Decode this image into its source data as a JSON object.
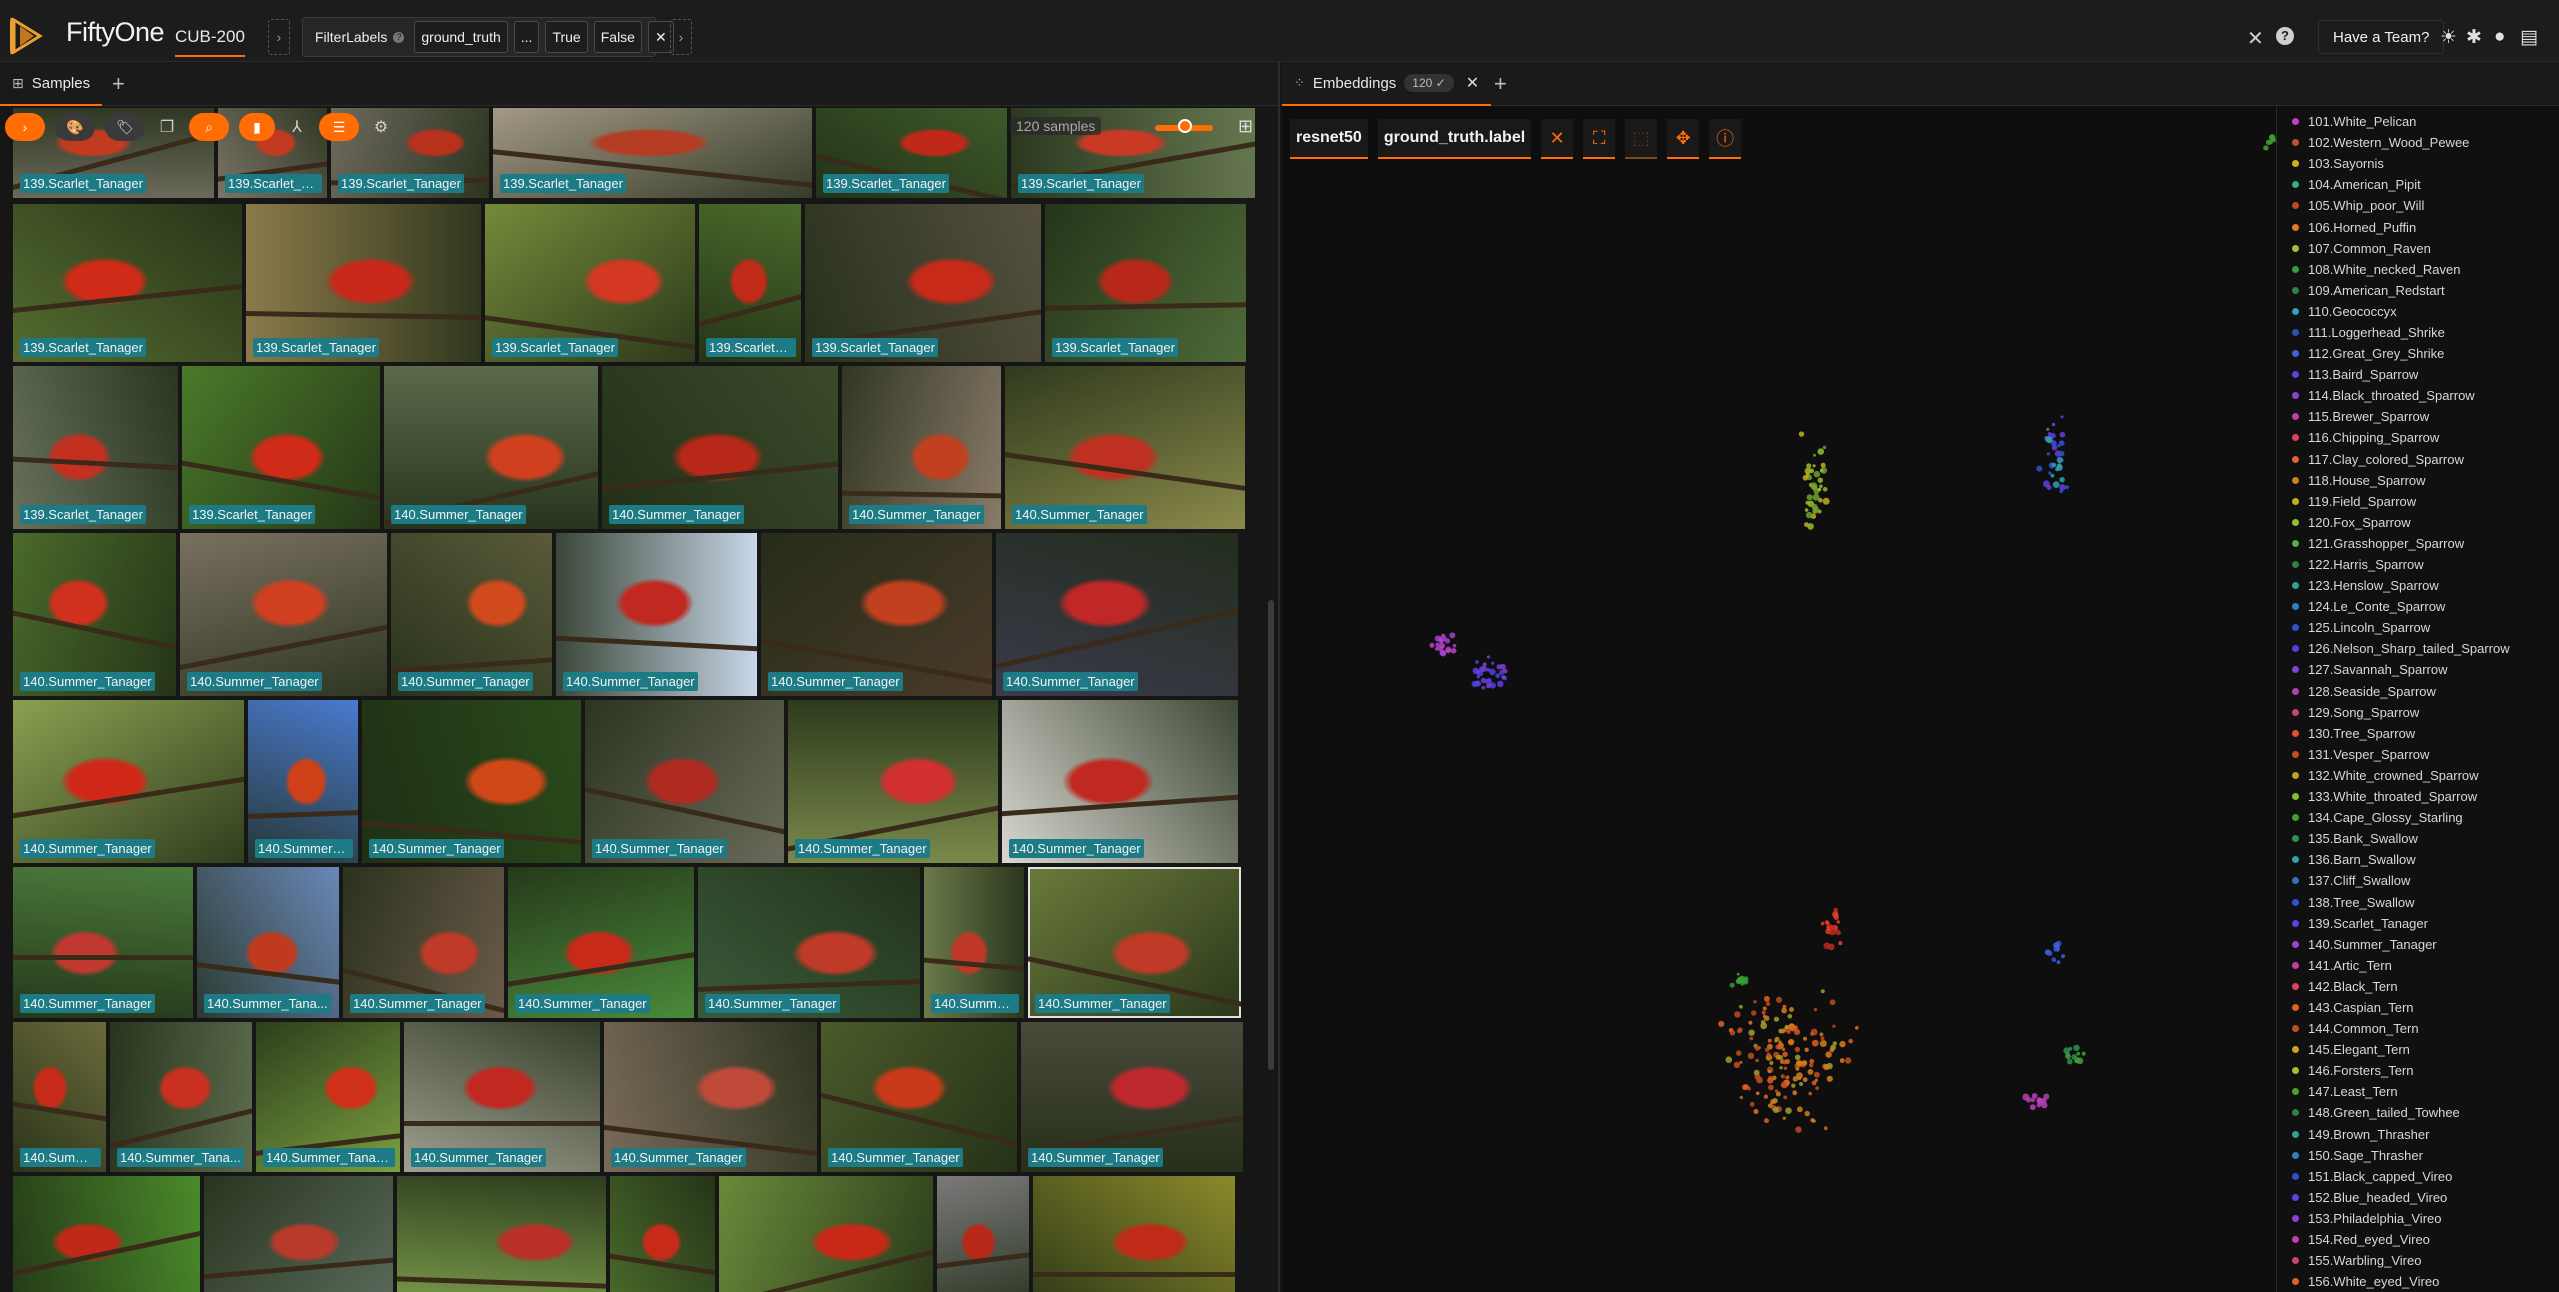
{
  "app": {
    "title": "FiftyOne",
    "dataset": "CUB-200",
    "team_button": "Have a Team?"
  },
  "filter": {
    "operator": "FilterLabels",
    "field": "ground_truth",
    "ellipsis": "...",
    "true_label": "True",
    "false_label": "False"
  },
  "samples_panel": {
    "tab_label": "Samples",
    "count_text": "120 samples"
  },
  "embeddings_panel": {
    "tab_label": "Embeddings",
    "badge": "120 ✓",
    "brain_key": "resnet50",
    "color_by": "ground_truth.label"
  },
  "colors": {
    "accent": "#ff6d04",
    "label_bg": "#1d7b86",
    "background": "#161616"
  },
  "grid": {
    "rows": [
      [
        {
          "label": "139.Scarlet_Tanager",
          "c1": "#6b6a5a",
          "c2": "#c23a20"
        },
        {
          "label": "139.Scarlet_Ta...",
          "c1": "#7a7466",
          "c2": "#c23a20"
        },
        {
          "label": "139.Scarlet_Tanager",
          "c1": "#6e6a5e",
          "c2": "#b8311c"
        },
        {
          "label": "139.Scarlet_Tanager",
          "c1": "#a59a88",
          "c2": "#b43c22"
        },
        {
          "label": "139.Scarlet_Tanager",
          "c1": "#3e5a2a",
          "c2": "#c0281a"
        },
        {
          "label": "139.Scarlet_Tanager",
          "c1": "#667850",
          "c2": "#c83a24"
        }
      ],
      [
        {
          "label": "139.Scarlet_Tanager",
          "c1": "#556b2f",
          "c2": "#d02a18"
        },
        {
          "label": "139.Scarlet_Tanager",
          "c1": "#8a7a4a",
          "c2": "#c8281a"
        },
        {
          "label": "139.Scarlet_Tanager",
          "c1": "#748a3a",
          "c2": "#d43822"
        },
        {
          "label": "139.Scarlet_T...",
          "c1": "#4a6a2a",
          "c2": "#c02a18"
        },
        {
          "label": "139.Scarlet_Tanager",
          "c1": "#55503e",
          "c2": "#c82a1a"
        },
        {
          "label": "139.Scarlet_Tanager",
          "c1": "#4e6a38",
          "c2": "#b82818"
        }
      ],
      [
        {
          "label": "139.Scarlet_Tanager",
          "c1": "#66705a",
          "c2": "#c43020"
        },
        {
          "label": "139.Scarlet_Tanager",
          "c1": "#4a7a2a",
          "c2": "#d02a18"
        },
        {
          "label": "140.Summer_Tanager",
          "c1": "#5a6a4a",
          "c2": "#d0401e"
        },
        {
          "label": "140.Summer_Tanager",
          "c1": "#3a4a2a",
          "c2": "#b82818"
        },
        {
          "label": "140.Summer_Tanager",
          "c1": "#8a7a6a",
          "c2": "#c04020"
        },
        {
          "label": "140.Summer_Tanager",
          "c1": "#8a8a4a",
          "c2": "#c03020"
        }
      ],
      [
        {
          "label": "140.Summer_Tanager",
          "c1": "#4a6a2a",
          "c2": "#d0301e"
        },
        {
          "label": "140.Summer_Tanager",
          "c1": "#7a7060",
          "c2": "#d04020"
        },
        {
          "label": "140.Summer_Tanager",
          "c1": "#5a5a3a",
          "c2": "#d04a1e"
        },
        {
          "label": "140.Summer_Tanager",
          "c1": "#c8d6e8",
          "c2": "#c02820"
        },
        {
          "label": "140.Summer_Tanager",
          "c1": "#4a3a2a",
          "c2": "#c04020"
        },
        {
          "label": "140.Summer_Tanager",
          "c1": "#3a3a4a",
          "c2": "#c02828"
        }
      ],
      [
        {
          "label": "140.Summer_Tanager",
          "c1": "#8aa050",
          "c2": "#d02818"
        },
        {
          "label": "140.Summer_...",
          "c1": "#4a7ad0",
          "c2": "#d04018"
        },
        {
          "label": "140.Summer_Tanager",
          "c1": "#2a4a1a",
          "c2": "#d04818"
        },
        {
          "label": "140.Summer_Tanager",
          "c1": "#6a6a5a",
          "c2": "#b02a20"
        },
        {
          "label": "140.Summer_Tanager",
          "c1": "#7a8a4a",
          "c2": "#d03030"
        },
        {
          "label": "140.Summer_Tanager",
          "c1": "#d8d8d0",
          "c2": "#c02820"
        }
      ],
      [
        {
          "label": "140.Summer_Tanager",
          "c1": "#4a7a3a",
          "c2": "#c03830"
        },
        {
          "label": "140.Summer_Tana...",
          "c1": "#6a88b8",
          "c2": "#c03a20"
        },
        {
          "label": "140.Summer_Tanager",
          "c1": "#6a5a4a",
          "c2": "#c03a28"
        },
        {
          "label": "140.Summer_Tanager",
          "c1": "#4a8a3a",
          "c2": "#c82a1a"
        },
        {
          "label": "140.Summer_Tanager",
          "c1": "#3a5a3a",
          "c2": "#c03a28"
        },
        {
          "label": "140.Summer_...",
          "c1": "#6a7a4a",
          "c2": "#c03828"
        },
        {
          "label": "140.Summer_Tanager",
          "c1": "#6a7a3a",
          "c2": "#c03a28"
        }
      ],
      [
        {
          "label": "140.Summe...",
          "c1": "#6a6a3a",
          "c2": "#c82a1a"
        },
        {
          "label": "140.Summer_Tana...",
          "c1": "#5a6a4a",
          "c2": "#c83020"
        },
        {
          "label": "140.Summer_Tanag...",
          "c1": "#7aa040",
          "c2": "#d03018"
        },
        {
          "label": "140.Summer_Tanager",
          "c1": "#a0a090",
          "c2": "#c02820"
        },
        {
          "label": "140.Summer_Tanager",
          "c1": "#7a6a5a",
          "c2": "#c04a3a"
        },
        {
          "label": "140.Summer_Tanager",
          "c1": "#4a5a2a",
          "c2": "#c83a1a"
        },
        {
          "label": "140.Summer_Tanager",
          "c1": "#4a4a3a",
          "c2": "#c02830"
        }
      ],
      [
        {
          "label": "",
          "c1": "#4a8a2a",
          "c2": "#c02818"
        },
        {
          "label": "",
          "c1": "#5a6a5a",
          "c2": "#b83a2a"
        },
        {
          "label": "",
          "c1": "#7a9a4a",
          "c2": "#b83028"
        },
        {
          "label": "",
          "c1": "#4a6a2a",
          "c2": "#c82a18"
        },
        {
          "label": "",
          "c1": "#6a8a3a",
          "c2": "#c82818"
        },
        {
          "label": "",
          "c1": "#7a7a7a",
          "c2": "#b82818"
        },
        {
          "label": "",
          "c1": "#8a8a2a",
          "c2": "#c02a18"
        }
      ]
    ]
  },
  "legend": [
    {
      "label": "101.White_Pelican",
      "color": "#c040c0"
    },
    {
      "label": "102.Western_Wood_Pewee",
      "color": "#c05030"
    },
    {
      "label": "103.Sayornis",
      "color": "#d0b020"
    },
    {
      "label": "104.American_Pipit",
      "color": "#30b080"
    },
    {
      "label": "105.Whip_poor_Will",
      "color": "#c04a20"
    },
    {
      "label": "106.Horned_Puffin",
      "color": "#e07a20"
    },
    {
      "label": "107.Common_Raven",
      "color": "#a0c030"
    },
    {
      "label": "108.White_necked_Raven",
      "color": "#30a040"
    },
    {
      "label": "109.American_Redstart",
      "color": "#308050"
    },
    {
      "label": "110.Geococcyx",
      "color": "#30a0c0"
    },
    {
      "label": "111.Loggerhead_Shrike",
      "color": "#3050b0"
    },
    {
      "label": "112.Great_Grey_Shrike",
      "color": "#4060e0"
    },
    {
      "label": "113.Baird_Sparrow",
      "color": "#6040e0"
    },
    {
      "label": "114.Black_throated_Sparrow",
      "color": "#9040d0"
    },
    {
      "label": "115.Brewer_Sparrow",
      "color": "#c040a0"
    },
    {
      "label": "116.Chipping_Sparrow",
      "color": "#e04060"
    },
    {
      "label": "117.Clay_colored_Sparrow",
      "color": "#e06030"
    },
    {
      "label": "118.House_Sparrow",
      "color": "#d08020"
    },
    {
      "label": "119.Field_Sparrow",
      "color": "#c0b020"
    },
    {
      "label": "120.Fox_Sparrow",
      "color": "#90c030"
    },
    {
      "label": "121.Grasshopper_Sparrow",
      "color": "#50b040"
    },
    {
      "label": "122.Harris_Sparrow",
      "color": "#308040"
    },
    {
      "label": "123.Henslow_Sparrow",
      "color": "#30a090"
    },
    {
      "label": "124.Le_Conte_Sparrow",
      "color": "#3080c0"
    },
    {
      "label": "125.Lincoln_Sparrow",
      "color": "#3050d0"
    },
    {
      "label": "126.Nelson_Sharp_tailed_Sparrow",
      "color": "#5040e0"
    },
    {
      "label": "127.Savannah_Sparrow",
      "color": "#8040d0"
    },
    {
      "label": "128.Seaside_Sparrow",
      "color": "#b040b0"
    },
    {
      "label": "129.Song_Sparrow",
      "color": "#d04070"
    },
    {
      "label": "130.Tree_Sparrow",
      "color": "#e05030"
    },
    {
      "label": "131.Vesper_Sparrow",
      "color": "#c05020"
    },
    {
      "label": "132.White_crowned_Sparrow",
      "color": "#c0a020"
    },
    {
      "label": "133.White_throated_Sparrow",
      "color": "#80c030"
    },
    {
      "label": "134.Cape_Glossy_Starling",
      "color": "#40a030"
    },
    {
      "label": "135.Bank_Swallow",
      "color": "#309050"
    },
    {
      "label": "136.Barn_Swallow",
      "color": "#30a0b0"
    },
    {
      "label": "137.Cliff_Swallow",
      "color": "#3070c0"
    },
    {
      "label": "138.Tree_Swallow",
      "color": "#3050e0"
    },
    {
      "label": "139.Scarlet_Tanager",
      "color": "#6040e0"
    },
    {
      "label": "140.Summer_Tanager",
      "color": "#a040d0"
    },
    {
      "label": "141.Artic_Tern",
      "color": "#c040a0"
    },
    {
      "label": "142.Black_Tern",
      "color": "#e04060"
    },
    {
      "label": "143.Caspian_Tern",
      "color": "#e06020"
    },
    {
      "label": "144.Common_Tern",
      "color": "#c05020"
    },
    {
      "label": "145.Elegant_Tern",
      "color": "#d0a020"
    },
    {
      "label": "146.Forsters_Tern",
      "color": "#a0c030"
    },
    {
      "label": "147.Least_Tern",
      "color": "#50a030"
    },
    {
      "label": "148.Green_tailed_Towhee",
      "color": "#308040"
    },
    {
      "label": "149.Brown_Thrasher",
      "color": "#30a090"
    },
    {
      "label": "150.Sage_Thrasher",
      "color": "#3080c0"
    },
    {
      "label": "151.Black_capped_Vireo",
      "color": "#3050d0"
    },
    {
      "label": "152.Blue_headed_Vireo",
      "color": "#6040e0"
    },
    {
      "label": "153.Philadelphia_Vireo",
      "color": "#9040d0"
    },
    {
      "label": "154.Red_eyed_Vireo",
      "color": "#c040b0"
    },
    {
      "label": "155.Warbling_Vireo",
      "color": "#d04070"
    },
    {
      "label": "156.White_eyed_Vireo",
      "color": "#e06030"
    }
  ],
  "icons": {
    "expand": "chevron-right-icon",
    "color_scheme": "palette-icon",
    "tags": "tag-icon",
    "clone": "copy-icon",
    "search": "search-icon",
    "bookmark": "bookmark-icon",
    "sort": "merge-icon",
    "list": "list-icon",
    "settings": "gear-icon",
    "grid": "grid-icon"
  }
}
